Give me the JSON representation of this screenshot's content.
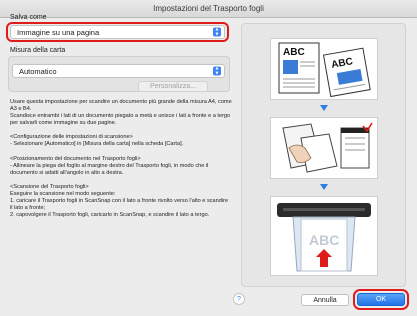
{
  "window": {
    "title": "Impostazioni del Trasporto fogli"
  },
  "save_as": {
    "label": "Salva come",
    "selected": "Immagine su una pagina"
  },
  "paper_size": {
    "label": "Misura della carta",
    "selected": "Automatico",
    "customize_label": "Personalizza..."
  },
  "description": {
    "paragraphs": [
      "Usare questa impostazione per scandire un documento più grande della misura A4, come A3 e B4.\nScandisce entrambi i lati di un documento piegato a metà e unisce i lati a fronte e a tergo per salvarli come immagine su due pagine.",
      "<Configurazione delle impostazioni di scansione>\n- Selezionare [Automatico] in [Misura della carta] nella scheda [Carta].",
      "<Posizionamento del documento nel Trasporto fogli>\n- Allineare la piega del foglio al margine destro del Trasporto fogli, in modo che il documento si adatti all'angolo in alto a destra.",
      "<Scansione del Trasporto fogli>\nEseguire la scansione nel modo seguente:\n1. caricare il Trasporto fogli in ScanSnap con il lato a fronte rivolto verso l'alto e scandire il lato a fronte;\n2. capovolgere il Trasporto fogli, caricarlo in ScanSnap, e scandire il lato a tergo."
    ]
  },
  "illustration": {
    "tile1_texts": [
      "ABC",
      "ABC"
    ],
    "tile3_text": "ABC"
  },
  "footer": {
    "help_label": "?",
    "cancel_label": "Annulla",
    "ok_label": "OK"
  },
  "colors": {
    "accent": "#1f74e6",
    "highlight": "#e01b1b",
    "arrow": "#2f7fe0"
  }
}
